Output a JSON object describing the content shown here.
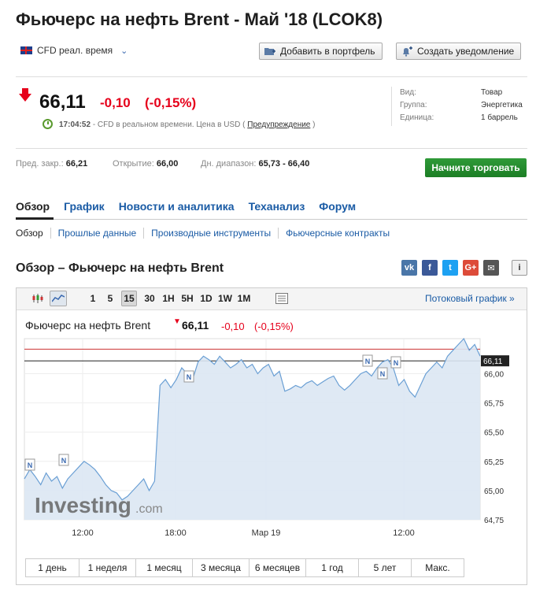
{
  "header": {
    "title": "Фьючерс на нефть Brent - Май '18 (LCOK8)",
    "cfd_label": "CFD реал. время",
    "add_portfolio": "Добавить в портфель",
    "create_alert": "Создать уведомление"
  },
  "quote": {
    "price": "66,11",
    "change": "-0,10",
    "change_pct": "(-0,15%)",
    "time": "17:04:52",
    "realtime_text": "- CFD в реальном времени. Цена в USD (",
    "disclaimer": "Предупреждение",
    "realtime_close": ")",
    "down_color": "#e6001b"
  },
  "info": {
    "type_label": "Вид:",
    "type_value": "Товар",
    "group_label": "Группа:",
    "group_value": "Энергетика",
    "unit_label": "Единица:",
    "unit_value": "1 баррель"
  },
  "stats": {
    "prev_close_label": "Пред. закр.:",
    "prev_close": "66,21",
    "open_label": "Открытие:",
    "open": "66,00",
    "range_label": "Дн. диапазон:",
    "range": "65,73 - 66,40",
    "trade_button": "Начните торговать"
  },
  "tabs": [
    "Обзор",
    "График",
    "Новости и аналитика",
    "Теханализ",
    "Форум"
  ],
  "subtabs": [
    "Обзор",
    "Прошлые данные",
    "Производные инструменты",
    "Фьючерсные контракты"
  ],
  "overview_title": "Обзор – Фьючерс на нефть Brent",
  "share": [
    {
      "icon": "vk-icon",
      "glyph": "vk",
      "color": "#4a76a8"
    },
    {
      "icon": "facebook-icon",
      "glyph": "f",
      "color": "#3b5998"
    },
    {
      "icon": "twitter-icon",
      "glyph": "t",
      "color": "#1da1f2"
    },
    {
      "icon": "google-plus-icon",
      "glyph": "G+",
      "color": "#dd4b39"
    },
    {
      "icon": "email-icon",
      "glyph": "✉",
      "color": "#555555"
    },
    {
      "icon": "info-icon",
      "glyph": "i",
      "color": "#f0f0f0"
    }
  ],
  "toolbar": {
    "intervals": [
      "1",
      "5",
      "15",
      "30",
      "1H",
      "5H",
      "1D",
      "1W",
      "1M"
    ],
    "selected_interval": "15",
    "stream_chart": "Потоковый график »"
  },
  "chart_title": "Фьючерс на нефть Brent",
  "watermark": "Investing",
  "watermark_suffix": ".com",
  "chart_data": {
    "type": "area",
    "x_labels": [
      "12:00",
      "18:00",
      "Мар 19",
      "12:00"
    ],
    "y_ticks": [
      "66,00",
      "65,75",
      "65,50",
      "65,25",
      "65,00",
      "64,75"
    ],
    "ylim": [
      64.75,
      66.3
    ],
    "last_price": 66.11,
    "last_price_label": "66,11",
    "prev_close": 66.21,
    "news_markers": 6,
    "series": [
      {
        "values": [
          65.1,
          65.18,
          65.12,
          65.05,
          65.15,
          65.08,
          65.12,
          65.02,
          65.1,
          65.15,
          65.2,
          65.25,
          65.22,
          65.18,
          65.12,
          65.05,
          65.0,
          64.98,
          64.92,
          64.95,
          65.0,
          65.05,
          65.1,
          65.0,
          65.08,
          65.9,
          65.95,
          65.88,
          65.95,
          66.05,
          66.0,
          65.95,
          66.1,
          66.15,
          66.12,
          66.08,
          66.15,
          66.1,
          66.05,
          66.08,
          66.12,
          66.05,
          66.08,
          66.0,
          66.05,
          66.08,
          65.98,
          66.02,
          65.85,
          65.87,
          65.9,
          65.88,
          65.92,
          65.94,
          65.9,
          65.93,
          65.96,
          65.98,
          65.9,
          65.86,
          65.9,
          65.95,
          66.0,
          66.02,
          65.98,
          66.05,
          66.1,
          66.12,
          66.05,
          65.9,
          65.95,
          65.85,
          65.8,
          65.9,
          66.0,
          66.05,
          66.1,
          66.05,
          66.15,
          66.2,
          66.25,
          66.3,
          66.2,
          66.25,
          66.15
        ]
      }
    ]
  },
  "ranges": [
    "1 день",
    "1 неделя",
    "1 месяц",
    "3 месяца",
    "6 месяцев",
    "1 год",
    "5 лет",
    "Макс."
  ]
}
